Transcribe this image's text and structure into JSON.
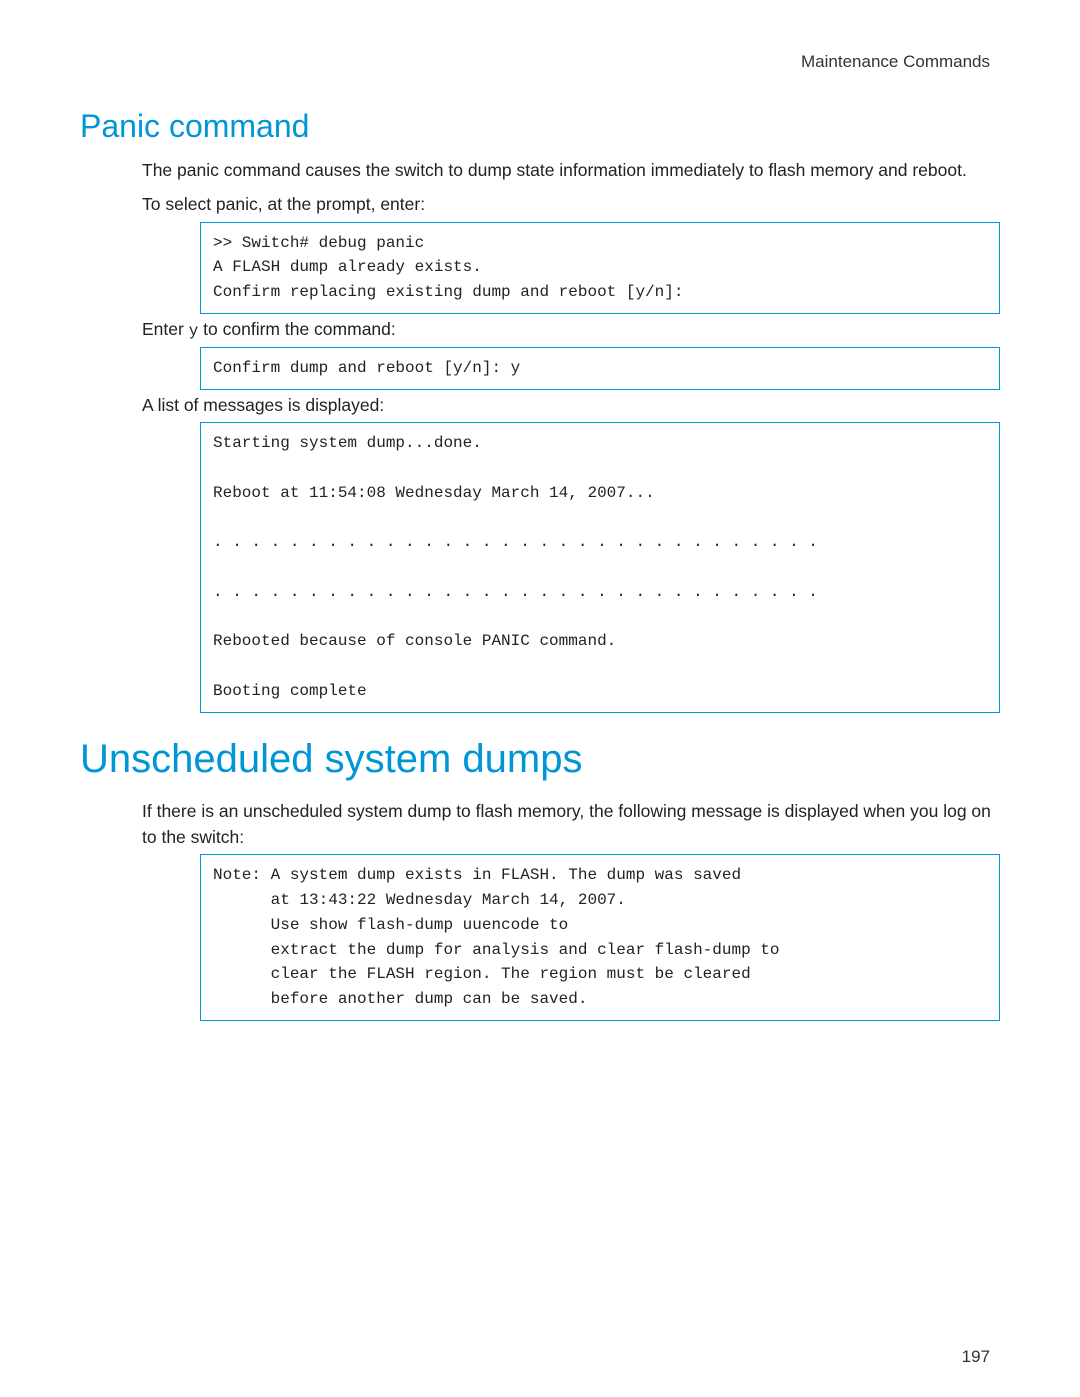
{
  "header": {
    "section_label": "Maintenance Commands"
  },
  "panic": {
    "title": "Panic command",
    "intro": "The panic command causes the switch to dump state information immediately to flash memory and reboot.",
    "select_text": "To select panic, at the prompt, enter:",
    "code1": ">> Switch# debug panic\nA FLASH dump already exists.\nConfirm replacing existing dump and reboot [y/n]:",
    "enter_text_pre": "Enter ",
    "enter_y": "y",
    "enter_text_post": " to confirm the command:",
    "code2": "Confirm dump and reboot [y/n]: y",
    "list_text": "A list of messages is displayed:",
    "code3": "Starting system dump...done.\n\nReboot at 11:54:08 Wednesday March 14, 2007...\n\n. . . . . . . . . . . . . . . . . . . . . . . . . . . . . . . .\n\n. . . . . . . . . . . . . . . . . . . . . . . . . . . . . . . .\n\nRebooted because of console PANIC command.\n\nBooting complete"
  },
  "unscheduled": {
    "title": "Unscheduled system dumps",
    "intro": "If there is an unscheduled system dump to flash memory, the following message is displayed when you log on to the switch:",
    "code1": "Note: A system dump exists in FLASH. The dump was saved\n      at 13:43:22 Wednesday March 14, 2007.\n      Use show flash-dump uuencode to\n      extract the dump for analysis and clear flash-dump to\n      clear the FLASH region. The region must be cleared\n      before another dump can be saved."
  },
  "page_number": "197"
}
